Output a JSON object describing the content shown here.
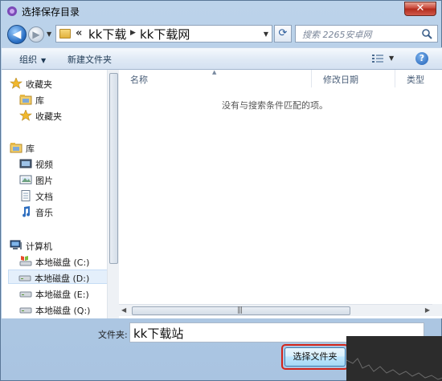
{
  "window": {
    "title": "选择保存目录",
    "close_glyph": "✕"
  },
  "nav": {
    "back_glyph": "◀",
    "forward_glyph": "▶",
    "address_prefix": "«",
    "breadcrumb": [
      "kk下载",
      "kk下载网"
    ],
    "refresh_glyph": "⟳",
    "search_placeholder": "搜索 2265安卓网"
  },
  "toolbar": {
    "organize": "组织",
    "new_folder": "新建文件夹",
    "help": "?"
  },
  "sidebar": {
    "groups": [
      {
        "label": "收藏夹",
        "icon": "star-icon",
        "items": [
          {
            "label": "库",
            "icon": "library-icon"
          },
          {
            "label": "收藏夹",
            "icon": "star-icon"
          }
        ]
      },
      {
        "label": "库",
        "icon": "library-icon",
        "items": [
          {
            "label": "视频",
            "icon": "video-icon"
          },
          {
            "label": "图片",
            "icon": "picture-icon"
          },
          {
            "label": "文档",
            "icon": "document-icon"
          },
          {
            "label": "音乐",
            "icon": "music-icon"
          }
        ]
      },
      {
        "label": "计算机",
        "icon": "computer-icon",
        "items": [
          {
            "label": "本地磁盘 (C:)",
            "icon": "drive-icon"
          },
          {
            "label": "本地磁盘 (D:)",
            "icon": "drive-icon",
            "selected": true
          },
          {
            "label": "本地磁盘 (E:)",
            "icon": "drive-icon"
          },
          {
            "label": "本地磁盘 (Q:)",
            "icon": "drive-icon"
          }
        ]
      }
    ]
  },
  "filelist": {
    "columns": [
      "名称",
      "修改日期",
      "类型"
    ],
    "empty_message": "没有与搜索条件匹配的项。"
  },
  "footer": {
    "folder_label": "文件夹:",
    "folder_value": "kk下载站",
    "select_button": "选择文件夹"
  },
  "colors": {
    "accent": "#d4251a",
    "frame": "#bcd3ea"
  }
}
